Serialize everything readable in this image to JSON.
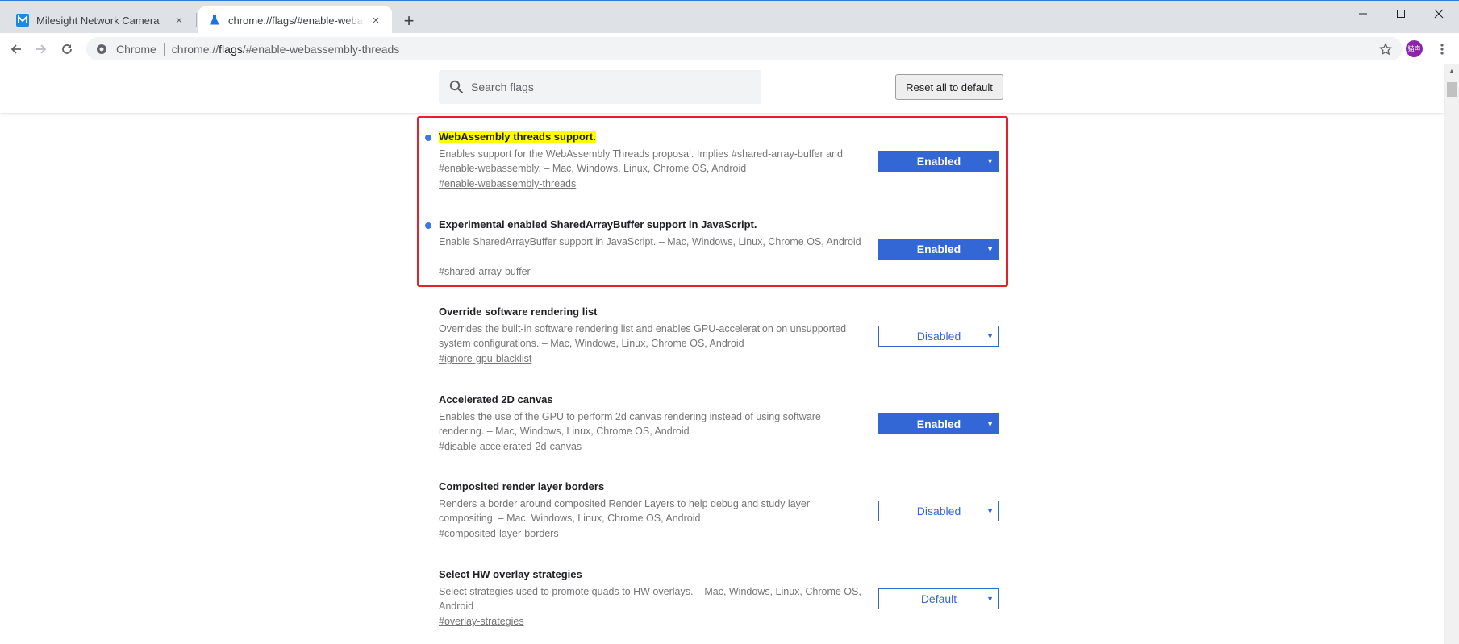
{
  "browser": {
    "tabs": [
      {
        "title": "Milesight Network Camera",
        "active": false,
        "icon": "milesight-logo-icon"
      },
      {
        "title": "chrome://flags/#enable-webassembly-threads",
        "active": true,
        "icon": "flask-icon"
      }
    ],
    "new_tab_label": "+",
    "omnibox": {
      "chip": "Chrome",
      "url_prefix": "chrome://",
      "url_host": "flags",
      "url_suffix": "/#enable-webassembly-threads"
    },
    "avatar_text": "猫声"
  },
  "flags_page": {
    "search_placeholder": "Search flags",
    "reset_label": "Reset all to default",
    "flags": [
      {
        "name": "WebAssembly threads support.",
        "description": "Enables support for the WebAssembly Threads proposal. Implies #shared-array-buffer and #enable-webassembly. – Mac, Windows, Linux, Chrome OS, Android",
        "permalink": "#enable-webassembly-threads",
        "state": "Enabled",
        "modified": true,
        "search_match": true
      },
      {
        "name": "Experimental enabled SharedArrayBuffer support in JavaScript.",
        "description": "Enable SharedArrayBuffer support in JavaScript. – Mac, Windows, Linux, Chrome OS, Android",
        "permalink": "#shared-array-buffer",
        "state": "Enabled",
        "modified": true,
        "search_match": false
      },
      {
        "name": "Override software rendering list",
        "description": "Overrides the built-in software rendering list and enables GPU-acceleration on unsupported system configurations. – Mac, Windows, Linux, Chrome OS, Android",
        "permalink": "#ignore-gpu-blacklist",
        "state": "Disabled",
        "modified": false,
        "search_match": false
      },
      {
        "name": "Accelerated 2D canvas",
        "description": "Enables the use of the GPU to perform 2d canvas rendering instead of using software rendering. – Mac, Windows, Linux, Chrome OS, Android",
        "permalink": "#disable-accelerated-2d-canvas",
        "state": "Enabled",
        "modified": false,
        "search_match": false
      },
      {
        "name": "Composited render layer borders",
        "description": "Renders a border around composited Render Layers to help debug and study layer compositing. – Mac, Windows, Linux, Chrome OS, Android",
        "permalink": "#composited-layer-borders",
        "state": "Disabled",
        "modified": false,
        "search_match": false
      },
      {
        "name": "Select HW overlay strategies",
        "description": "Select strategies used to promote quads to HW overlays. – Mac, Windows, Linux, Chrome OS, Android",
        "permalink": "#overlay-strategies",
        "state": "Default",
        "modified": false,
        "search_match": false
      }
    ]
  },
  "colors": {
    "accent_blue": "#3367d6",
    "highlight_yellow": "#ffff00",
    "annotation_red": "#e8202a"
  }
}
